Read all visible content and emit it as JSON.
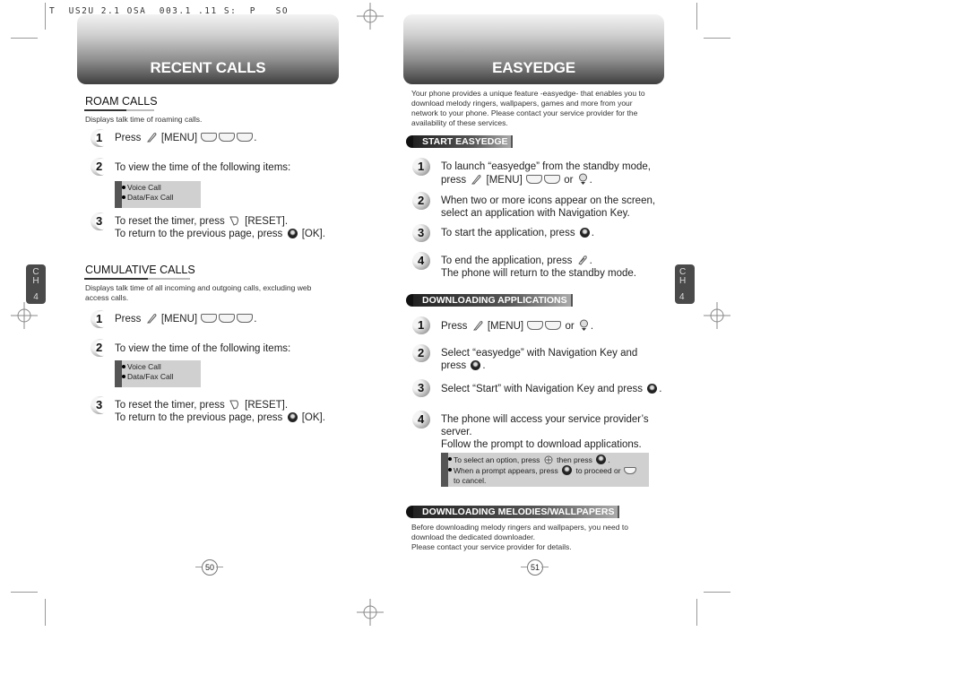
{
  "slug": "T  US2U 2.1 OSA  003.1 .11 S:  P   SO",
  "left_page": {
    "header_title": "RECENT CALLS",
    "chapter_tab": {
      "line1": "C",
      "line2": "H",
      "number": "4"
    },
    "roam": {
      "title": "ROAM CALLS",
      "description": "Displays talk time of roaming calls.",
      "steps": [
        {
          "num": "1",
          "text_a": "Press",
          "text_b": "[MENU]",
          "text_c": "."
        },
        {
          "num": "2",
          "text": "To view the time of the following items:"
        },
        {
          "num": "3",
          "line1_a": "To reset the timer, press",
          "line1_b": "[RESET].",
          "line2_a": "To return to the previous page, press",
          "line2_b": "[OK]."
        }
      ],
      "note_items": [
        "Voice Call",
        "Data/Fax Call"
      ]
    },
    "cumulative": {
      "title": "CUMULATIVE CALLS",
      "description_line1": "Displays talk time of all incoming and outgoing calls, excluding web",
      "description_line2": "access calls.",
      "steps": [
        {
          "num": "1",
          "text_a": "Press",
          "text_b": "[MENU]",
          "text_c": "."
        },
        {
          "num": "2",
          "text": "To view the time of the following items:"
        },
        {
          "num": "3",
          "line1_a": "To reset the timer, press",
          "line1_b": "[RESET].",
          "line2_a": "To return to the previous page, press",
          "line2_b": "[OK]."
        }
      ],
      "note_items": [
        "Voice Call",
        "Data/Fax Call"
      ]
    },
    "page_number": "50"
  },
  "right_page": {
    "header_title": "EASYEDGE",
    "chapter_tab": {
      "line1": "C",
      "line2": "H",
      "number": "4"
    },
    "intro": [
      "Your phone provides a unique feature -easyedge- that enables you to",
      "download melody ringers, wallpapers, games and more from your",
      "network to your phone. Please contact your service provider for the",
      "availability of these services."
    ],
    "start": {
      "title": "START EASYEDGE",
      "steps": [
        {
          "num": "1",
          "line1": "To launch “easyedge” from the standby mode,",
          "line2_a": "press",
          "line2_b": "[MENU]",
          "line2_c": "or",
          "line2_d": "."
        },
        {
          "num": "2",
          "line1": "When two or more icons appear on the screen,",
          "line2": "select an application with Navigation Key."
        },
        {
          "num": "3",
          "line1_a": "To start the application, press",
          "line1_b": "."
        },
        {
          "num": "4",
          "line1_a": "To end the application, press",
          "line1_b": ".",
          "line2": "The phone will return to the standby mode."
        }
      ]
    },
    "downloading_apps": {
      "title": "DOWNLOADING APPLICATIONS",
      "steps": [
        {
          "num": "1",
          "text_a": "Press",
          "text_b": "[MENU]",
          "text_c": "or",
          "text_d": "."
        },
        {
          "num": "2",
          "line1": "Select “easyedge” with Navigation Key and",
          "line2_a": "press",
          "line2_b": "."
        },
        {
          "num": "3",
          "line1_a": "Select “Start” with Navigation Key and press",
          "line1_b": "."
        },
        {
          "num": "4",
          "line1": "The phone will access your service provider’s",
          "line2": "server.",
          "line3": "Follow the prompt to download applications."
        }
      ],
      "note": {
        "item1_a": "To select an option, press",
        "item1_b": "then press",
        "item1_c": ".",
        "item2_a": "When a prompt appears, press",
        "item2_b": "to proceed or",
        "item2_c": "to cancel."
      }
    },
    "downloading_melodies": {
      "title": "DOWNLOADING MELODIES/WALLPAPERS",
      "lines": [
        "Before downloading melody ringers and wallpapers, you need to",
        "download the dedicated downloader.",
        "Please contact your service provider for details."
      ]
    },
    "page_number": "51"
  }
}
